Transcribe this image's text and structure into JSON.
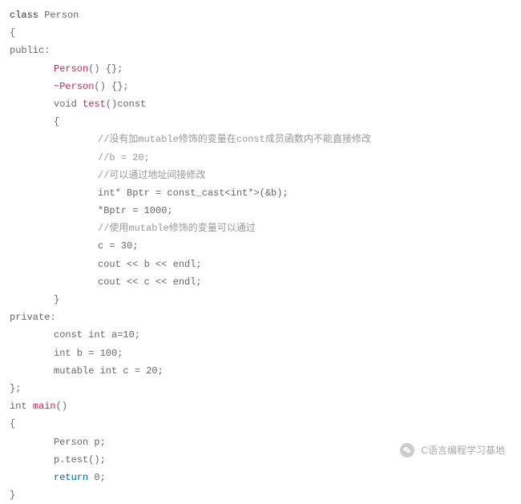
{
  "code": {
    "line1_class": "class",
    "line1_name": " Person",
    "line2": "{",
    "line3": "public:",
    "line4_fn": "Person",
    "line4_rest": "() {};",
    "line5_tilde": "~",
    "line5_fn": "Person",
    "line5_rest": "() {};",
    "line6_void": "void",
    "line6_space": " ",
    "line6_fn": "test",
    "line6_rest": "()const",
    "line7": "{",
    "line8": "//没有加mutable修饰的变量在const成员函数内不能直接修改",
    "line9": "//b = 20;",
    "line10": "//可以通过地址间接修改",
    "line11": "int* Bptr = const_cast<int*>(&b);",
    "line12": "*Bptr = 1000;",
    "line13": "//使用mutable修饰的变量可以通过",
    "line14": "c = 30;",
    "line15": "cout << b << endl;",
    "line16": "cout << c << endl;",
    "line17": "}",
    "line18": "private:",
    "line19": "const int a=10;",
    "line20": "int b = 100;",
    "line21": "mutable int c = 20;",
    "line22": "};",
    "line23_int": "int ",
    "line23_fn": "main",
    "line23_rest": "()",
    "line24": "{",
    "line25": "Person p;",
    "line26": "p.test();",
    "line27_return": "return",
    "line27_rest": " 0;",
    "line28": "}"
  },
  "footer": {
    "text": "C语言编程学习基地"
  }
}
